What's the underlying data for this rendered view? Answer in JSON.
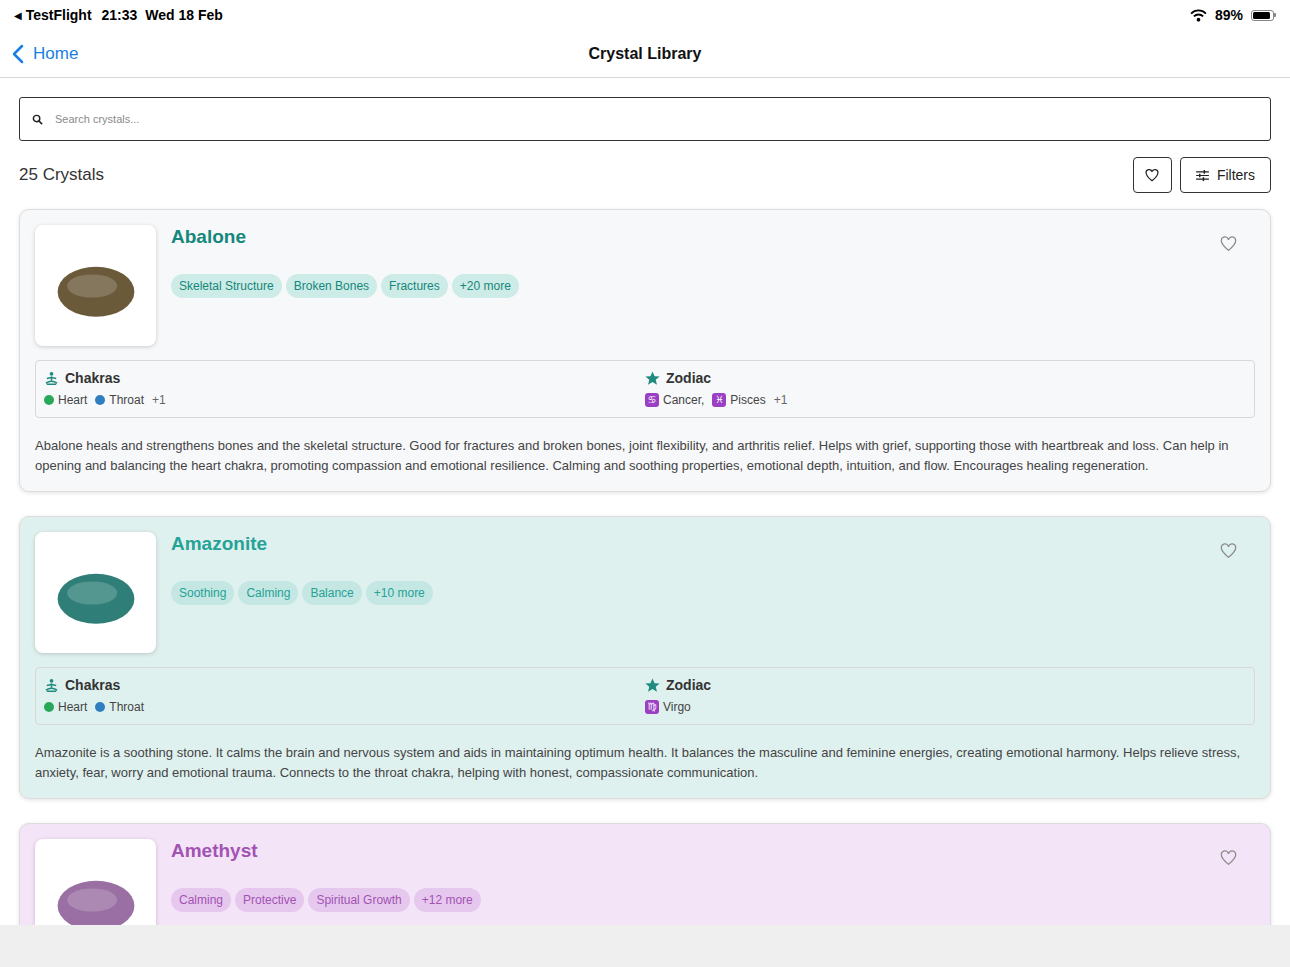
{
  "status_bar": {
    "back_glyph": "◀",
    "app": "TestFlight",
    "time": "21:33",
    "date": "Wed 18 Feb",
    "battery": {
      "text": "89%",
      "level": 0.89
    }
  },
  "nav": {
    "back": "Home",
    "title": "Crystal Library"
  },
  "search": {
    "placeholder": "Search crystals..."
  },
  "toolbar": {
    "count": "25 Crystals",
    "favorites_only": false,
    "filters": "Filters"
  },
  "crystals": [
    {
      "name": "Abalone",
      "color": "#15877b",
      "card_color": "#f7f8fa",
      "tag_color": "#cdece7",
      "photo_color": "#6b5a3a",
      "favorite": false,
      "tags": [
        "Skeletal Structure",
        "Broken Bones",
        "Fractures"
      ],
      "more": "+20 more",
      "chakras_title": "Chakras",
      "chakras": [
        {
          "name": "Heart",
          "color": "#2aa85a"
        },
        {
          "name": "Throat",
          "color": "#2f7fc0"
        }
      ],
      "chakras_more": "+1",
      "zodiac_title": "Zodiac",
      "zodiac": [
        {
          "symbol": "♋",
          "name": "Cancer,"
        },
        {
          "symbol": "♓",
          "name": "Pisces"
        }
      ],
      "zodiac_more": "+1",
      "description": "Abalone heals and strengthens bones and the skeletal structure. Good for fractures and broken bones, joint flexibility, and arthritis relief. Helps with grief, supporting those with heartbreak and loss. Can help in opening and balancing the heart chakra, promoting compassion and emotional resilience. Calming and soothing properties, emotional depth, intuition, and flow. Encourages healing regeneration."
    },
    {
      "name": "Amazonite",
      "color": "#26a296",
      "card_color": "#dff1ef",
      "tag_color": "#c4e7e3",
      "photo_color": "#2f7f78",
      "favorite": false,
      "tags": [
        "Soothing",
        "Calming",
        "Balance"
      ],
      "more": "+10 more",
      "chakras_title": "Chakras",
      "chakras": [
        {
          "name": "Heart",
          "color": "#2aa85a"
        },
        {
          "name": "Throat",
          "color": "#2f7fc0"
        }
      ],
      "chakras_more": "",
      "zodiac_title": "Zodiac",
      "zodiac": [
        {
          "symbol": "♍",
          "name": "Virgo"
        }
      ],
      "zodiac_more": "",
      "description": "Amazonite is a soothing stone. It calms the brain and nervous system and aids in maintaining optimum health. It balances the masculine and feminine energies, creating emotional harmony. Helps relieve stress, anxiety, fear, worry and emotional trauma. Connects to the throat chakra, helping with honest, compassionate communication."
    },
    {
      "name": "Amethyst",
      "color": "#a253b3",
      "card_color": "#f4e4f8",
      "tag_color": "#e6c8ee",
      "photo_color": "#9a6fa3",
      "favorite": false,
      "tags": [
        "Calming",
        "Protective",
        "Spiritual Growth"
      ],
      "more": "+12 more"
    }
  ]
}
